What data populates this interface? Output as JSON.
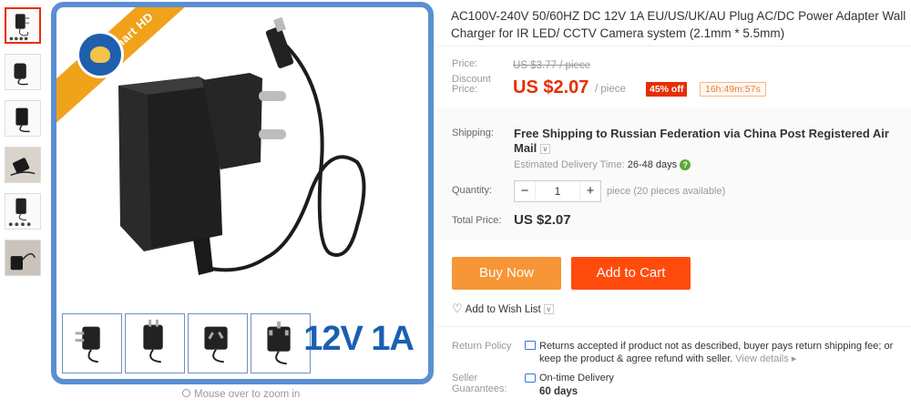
{
  "product": {
    "title": "AC100V-240V 50/60HZ DC 12V 1A EU/US/UK/AU Plug AC/DC Power Adapter Wall Charger for IR LED/ CCTV Camera system (2.1mm * 5.5mm)"
  },
  "gallery": {
    "brand_ribbon": "HSmart HD",
    "big_label": "12V 1A",
    "zoom_hint": "Mouse over to zoom in",
    "thumb_count": 6,
    "variant_count": 4
  },
  "price": {
    "price_label": "Price:",
    "original_price": "US $3.77 / piece",
    "discount_label": "Discount Price:",
    "discount_price": "US $2.07",
    "per_piece": "/ piece",
    "off_badge": "45% off",
    "timer": "16h:49m:57s"
  },
  "shipping": {
    "label": "Shipping:",
    "text": "Free Shipping to Russian Federation via China Post Registered Air Mail",
    "eta_label": "Estimated Delivery Time:",
    "eta_value": "26-48 days"
  },
  "quantity": {
    "label": "Quantity:",
    "minus": "−",
    "value": "1",
    "plus": "+",
    "note": "piece (20 pieces available)"
  },
  "total": {
    "label": "Total Price:",
    "value": "US $2.07"
  },
  "actions": {
    "buy_now": "Buy Now",
    "add_to_cart": "Add to Cart",
    "wish_list": "Add to Wish List"
  },
  "policy": {
    "return_label": "Return Policy",
    "return_text": "Returns accepted if product not as described, buyer pays return shipping fee; or keep the product & agree refund with seller.",
    "view_details": "View details ▸",
    "seller_label": "Seller Guarantees:",
    "seller_text": "On-time Delivery",
    "seller_days": "60 days"
  },
  "colors": {
    "accent_red": "#e62e04",
    "buy_orange": "#f79637",
    "cart_orange": "#ff4c0c",
    "frame_blue": "#5b8fd1"
  }
}
